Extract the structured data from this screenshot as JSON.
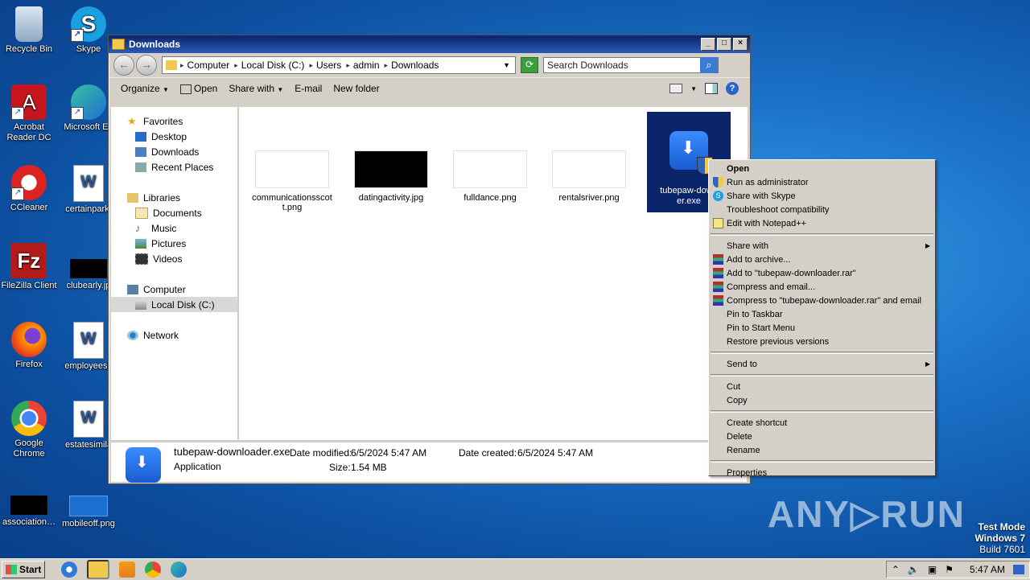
{
  "desktop": {
    "icons": [
      {
        "label": "Recycle Bin"
      },
      {
        "label": "Skype"
      },
      {
        "label": "Acrobat Reader DC"
      },
      {
        "label": "Microsoft Ed"
      },
      {
        "label": "CCleaner"
      },
      {
        "label": "certainpark."
      },
      {
        "label": "FileZilla Client"
      },
      {
        "label": "clubearly.jp"
      },
      {
        "label": "Firefox"
      },
      {
        "label": "employeesh"
      },
      {
        "label": "Google Chrome"
      },
      {
        "label": "estatesimila"
      },
      {
        "label": "association…"
      },
      {
        "label": "mobileoff.png"
      }
    ],
    "watermark": "ANY▷RUN",
    "testmode": {
      "line1": "Test Mode",
      "line2": "Windows 7",
      "line3": "Build 7601"
    }
  },
  "window": {
    "title": "Downloads",
    "controls": {
      "min": "_",
      "max": "□",
      "close": "×"
    },
    "address": {
      "crumbs": [
        "Computer",
        "Local Disk (C:)",
        "Users",
        "admin",
        "Downloads"
      ]
    },
    "search": {
      "placeholder": "Search Downloads"
    },
    "commands": {
      "organize": "Organize",
      "open": "Open",
      "share_with": "Share with",
      "email": "E-mail",
      "new_folder": "New folder"
    },
    "nav": {
      "favorites": "Favorites",
      "desktop": "Desktop",
      "downloads": "Downloads",
      "recent": "Recent Places",
      "libraries": "Libraries",
      "documents": "Documents",
      "music": "Music",
      "pictures": "Pictures",
      "videos": "Videos",
      "computer": "Computer",
      "localdisk": "Local Disk (C:)",
      "network": "Network"
    },
    "files": [
      {
        "name": "communicationsscott.png"
      },
      {
        "name": "datingactivity.jpg"
      },
      {
        "name": "fulldance.png"
      },
      {
        "name": "rentalsriver.png"
      },
      {
        "name": "tubepaw-downloader.exe",
        "display": "tubepaw-down er.exe"
      }
    ],
    "details": {
      "filename": "tubepaw-downloader.exe",
      "type": "Application",
      "modified_label": "Date modified:",
      "modified": "6/5/2024 5:47 AM",
      "created_label": "Date created:",
      "created": "6/5/2024 5:47 AM",
      "size_label": "Size:",
      "size": "1.54 MB"
    }
  },
  "context_menu": {
    "open": "Open",
    "run_admin": "Run as administrator",
    "share_skype": "Share with Skype",
    "troubleshoot": "Troubleshoot compatibility",
    "notepad": "Edit with Notepad++",
    "share_with": "Share with",
    "add_archive": "Add to archive...",
    "add_rar": "Add to \"tubepaw-downloader.rar\"",
    "compress_email": "Compress and email...",
    "compress_rar_email": "Compress to \"tubepaw-downloader.rar\" and email",
    "pin_taskbar": "Pin to Taskbar",
    "pin_start": "Pin to Start Menu",
    "restore": "Restore previous versions",
    "send_to": "Send to",
    "cut": "Cut",
    "copy": "Copy",
    "create_shortcut": "Create shortcut",
    "delete": "Delete",
    "rename": "Rename",
    "properties": "Properties"
  },
  "taskbar": {
    "start": "Start",
    "time": "5:47 AM"
  }
}
